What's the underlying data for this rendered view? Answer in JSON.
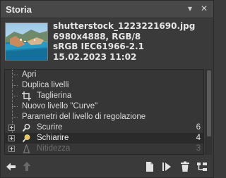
{
  "panel": {
    "title": "Storia",
    "buttons": {
      "menu_glyph": "▾",
      "close_glyph": "✕"
    }
  },
  "image_info": {
    "filename": "shutterstock_1223221690.jpg",
    "dimensions": "6980x4888, RGB/8",
    "color_profile": "sRGB IEC61966-2.1",
    "date": "15.02.2023 11:02"
  },
  "history": {
    "items": [
      {
        "label": "Apri",
        "icon": ""
      },
      {
        "label": "Duplica livelli",
        "icon": ""
      },
      {
        "label": "Taglierina",
        "icon": "crop-icon"
      },
      {
        "label": "Nuovo livello \"Curve\"",
        "icon": ""
      },
      {
        "label": "Parametri del livello di regolazione",
        "icon": ""
      },
      {
        "label": "Scurire",
        "icon": "burn-tool-icon",
        "count": "6",
        "expandable": true
      },
      {
        "label": "Schiarire",
        "icon": "dodge-tool-icon",
        "count": "4",
        "expandable": true,
        "selected": true
      },
      {
        "label": "Nitidezza",
        "icon": "sharpen-tool-icon",
        "count": "3",
        "expandable": true,
        "disabled": true
      }
    ]
  },
  "toolbar": {
    "icons": [
      "undo-arrow-icon",
      "redo-arrow-icon",
      "new-document-icon",
      "play-icon",
      "trash-icon",
      "hierarchy-icon"
    ]
  },
  "colors": {
    "panel_bg": "#3a3a3a",
    "titlebar_bg": "#484848",
    "selected_row_bg": "#2a2a2a",
    "text": "#dcdcdc",
    "disabled_text": "#6e6e6e"
  }
}
